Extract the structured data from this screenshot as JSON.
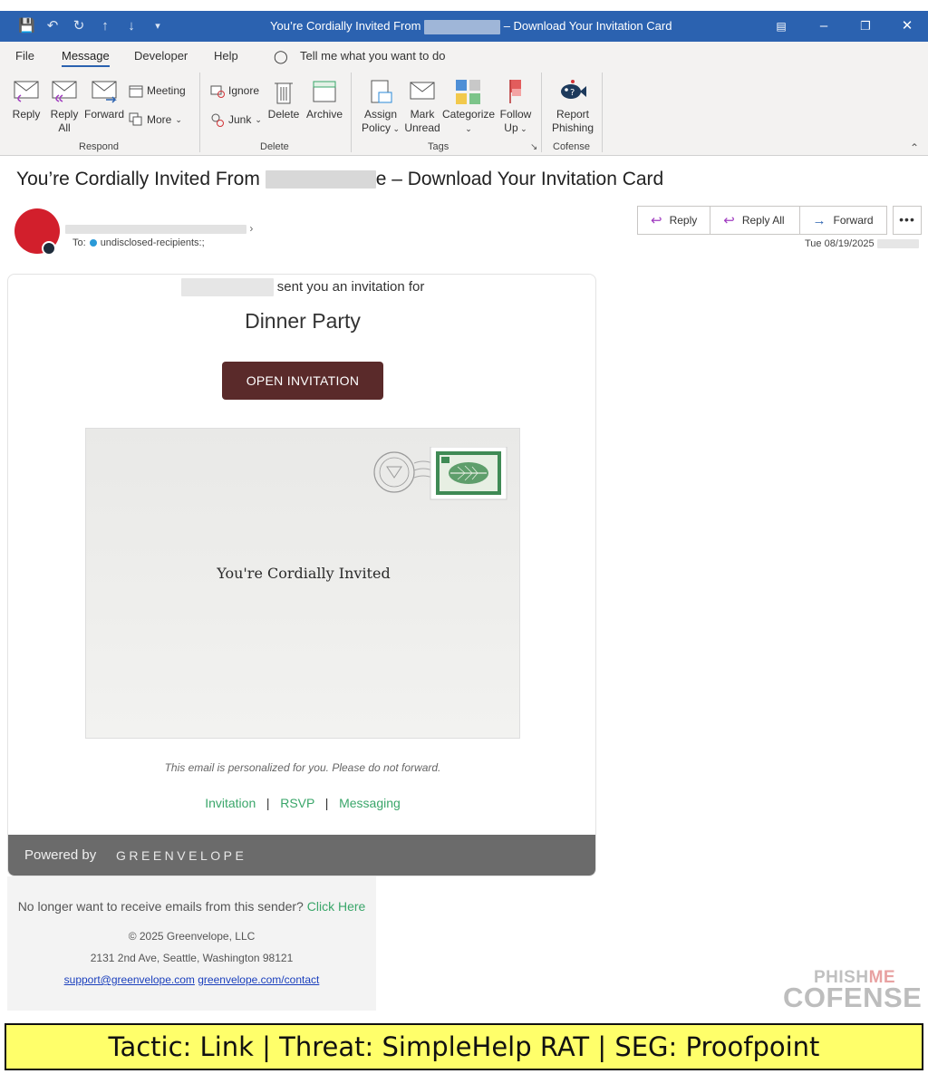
{
  "window": {
    "title_before": "You’re Cordially Invited From",
    "title_after": "– Download Your Invitation Card"
  },
  "ribbon": {
    "tabs": [
      "File",
      "Message",
      "Developer",
      "Help"
    ],
    "active_tab": "Message",
    "search_placeholder": "Tell me what you want to do",
    "respond": {
      "reply": "Reply",
      "reply_all_1": "Reply",
      "reply_all_2": "All",
      "forward": "Forward",
      "meeting": "Meeting",
      "more": "More",
      "group": "Respond"
    },
    "delete_group": {
      "ignore": "Ignore",
      "junk": "Junk",
      "delete": "Delete",
      "archive": "Archive",
      "group": "Delete"
    },
    "tags": {
      "assign_1": "Assign",
      "assign_2": "Policy",
      "mark_1": "Mark",
      "mark_2": "Unread",
      "categorize": "Categorize",
      "follow_1": "Follow",
      "follow_2": "Up",
      "group": "Tags"
    },
    "cofense": {
      "report_1": "Report",
      "report_2": "Phishing",
      "group": "Cofense"
    }
  },
  "message": {
    "subject_before": "You’re Cordially Invited From",
    "subject_after": "e – Download Your Invitation Card",
    "to_label": "To:",
    "recipients": "undisclosed-recipients:;",
    "actions": {
      "reply": "Reply",
      "reply_all": "Reply All",
      "forward": "Forward"
    },
    "date": "Tue 08/19/2025"
  },
  "email": {
    "sent_text": "sent you an invitation for",
    "event": "Dinner Party",
    "cta": "OPEN INVITATION",
    "envelope_text": "You're Cordially Invited",
    "personal_note": "This email is personalized for you. Please do not forward.",
    "links": [
      "Invitation",
      "RSVP",
      "Messaging"
    ],
    "powered_by": "Powered by",
    "brand": "GREENVELOPE",
    "unsubscribe_text": "No longer want to receive emails from this sender?",
    "unsubscribe_link": "Click Here",
    "copyright": "© 2025 Greenvelope, LLC",
    "address": "2131 2nd Ave, Seattle, Washington 98121",
    "support_email": "support@greenvelope.com",
    "contact_url": "greenvelope.com/contact"
  },
  "watermark": {
    "top": "PHISH",
    "top_accent": "ME",
    "main": "COFENSE"
  },
  "banner": {
    "text": "Tactic: Link | Threat: SimpleHelp RAT | SEG: Proofpoint"
  },
  "colors": {
    "titlebar": "#2b62b0",
    "cta": "#5a2a2a",
    "link_green": "#3aa66a",
    "banner": "#ffff6a",
    "avatar": "#d21f2c"
  }
}
